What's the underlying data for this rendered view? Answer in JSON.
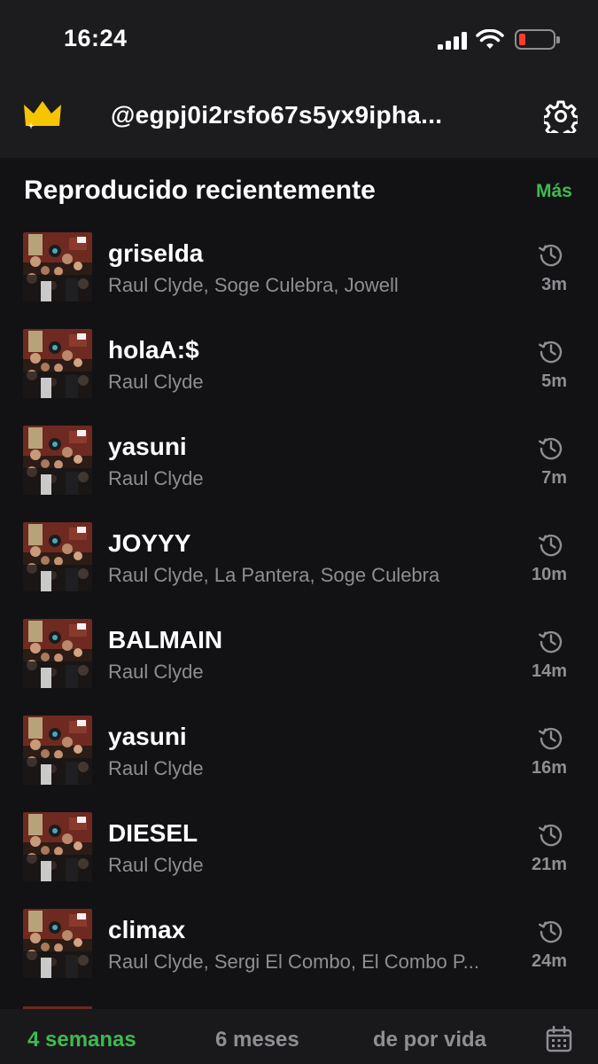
{
  "status_bar": {
    "time": "16:24",
    "battery_level": "low"
  },
  "header": {
    "username": "@egpj0i2rsfo67s5yx9ipha...",
    "premium_icon": "crown-icon",
    "settings_icon": "gear-icon"
  },
  "section": {
    "title": "Reproducido recientemente",
    "more_label": "Más"
  },
  "tracks": [
    {
      "title": "griselda",
      "artists": "Raul Clyde, Soge Culebra, Jowell",
      "ago": "3m"
    },
    {
      "title": "holaA:$",
      "artists": "Raul Clyde",
      "ago": "5m"
    },
    {
      "title": "yasuni",
      "artists": "Raul Clyde",
      "ago": "7m"
    },
    {
      "title": "JOYYY",
      "artists": "Raul Clyde, La Pantera, Soge Culebra",
      "ago": "10m"
    },
    {
      "title": "BALMAIN",
      "artists": "Raul Clyde",
      "ago": "14m"
    },
    {
      "title": "yasuni",
      "artists": "Raul Clyde",
      "ago": "16m"
    },
    {
      "title": "DIESEL",
      "artists": "Raul Clyde",
      "ago": "21m"
    },
    {
      "title": "climax",
      "artists": "Raul Clyde, Sergi El Combo, El Combo P...",
      "ago": "24m"
    }
  ],
  "tabs": [
    {
      "label": "4 semanas",
      "active": true
    },
    {
      "label": "6 meses",
      "active": false
    },
    {
      "label": "de por vida",
      "active": false
    }
  ],
  "colors": {
    "accent": "#3fb950",
    "background": "#121214",
    "secondary_text": "#8e8e93",
    "crown": "#f7c500"
  }
}
